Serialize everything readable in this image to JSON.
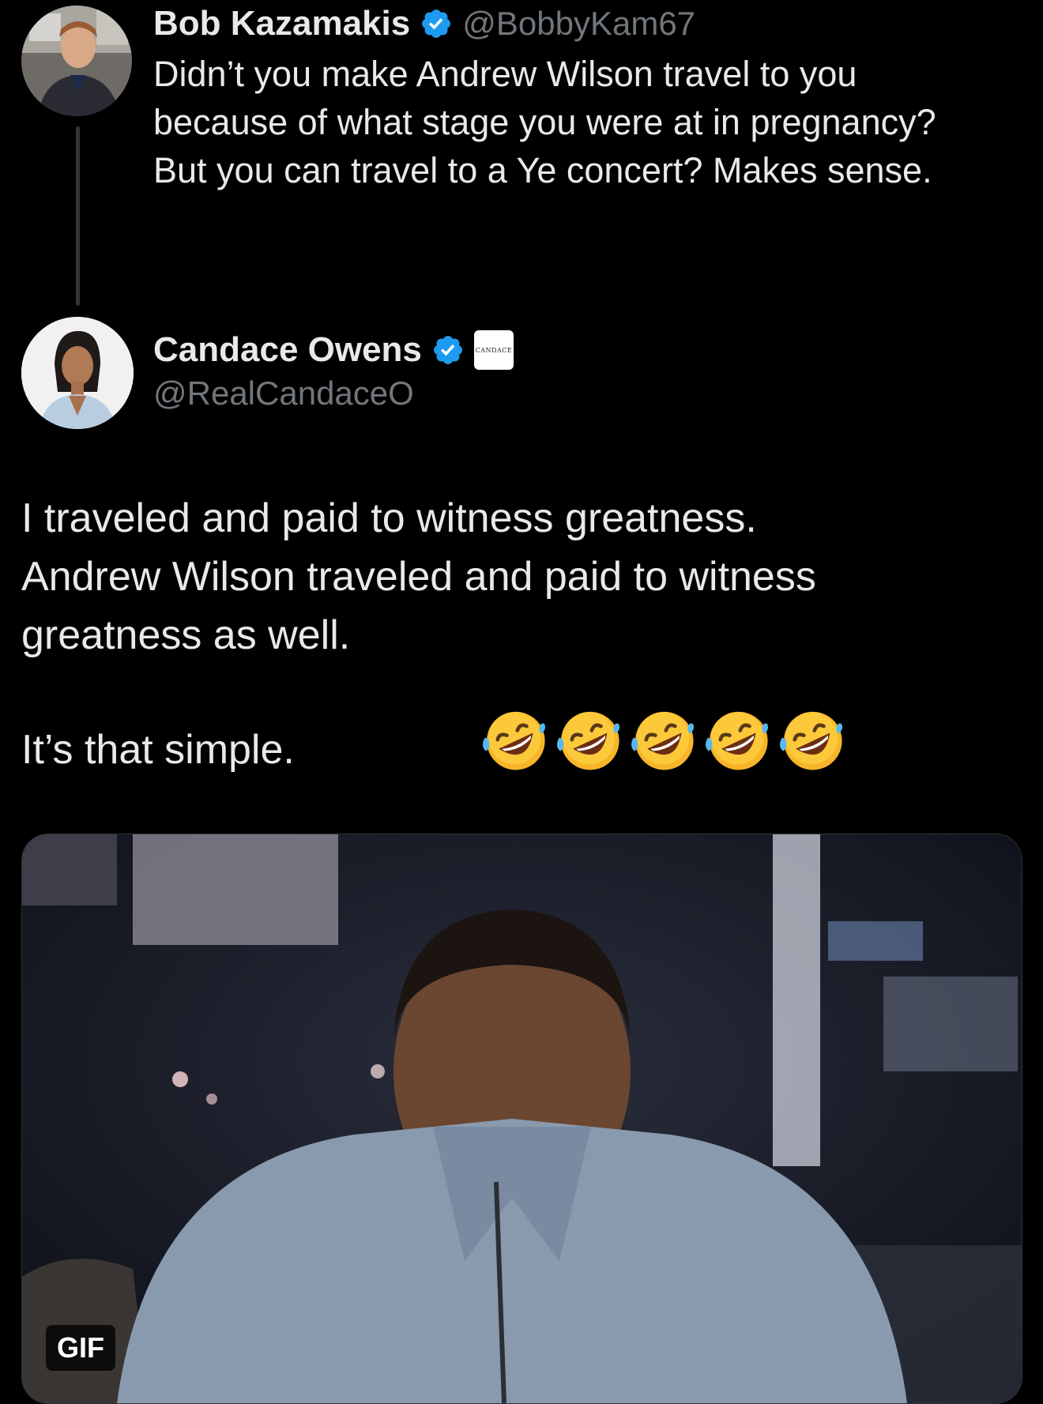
{
  "reply_tweet": {
    "author_name": "Bob Kazamakis",
    "author_handle": "@BobbyKam67",
    "lines": [
      "Didn’t you make Andrew Wilson travel to you",
      "because of what stage you were at in pregnancy?",
      "But you can travel to a Ye concert? Makes sense."
    ]
  },
  "main_tweet": {
    "author_name": "Candace Owens",
    "author_handle": "@RealCandaceO",
    "affiliate_badge_text": "CANDACE",
    "lines": [
      "I traveled and paid to witness greatness.",
      "Andrew Wilson traveled and paid to witness",
      "greatness as well."
    ],
    "closing_line": "It’s that simple.",
    "emoji_count": 5,
    "emoji_name": "rolling-on-the-floor-laughing",
    "media": {
      "type": "gif",
      "badge_label": "GIF"
    }
  },
  "colors": {
    "background": "#000000",
    "primary_text": "#e7e9ea",
    "secondary_text": "#71767b",
    "verified_blue": "#1d9bf0",
    "thread_line": "#333639"
  },
  "icons": [
    "verified-badge-icon",
    "affiliate-badge-icon",
    "laughing-emoji-icon"
  ]
}
